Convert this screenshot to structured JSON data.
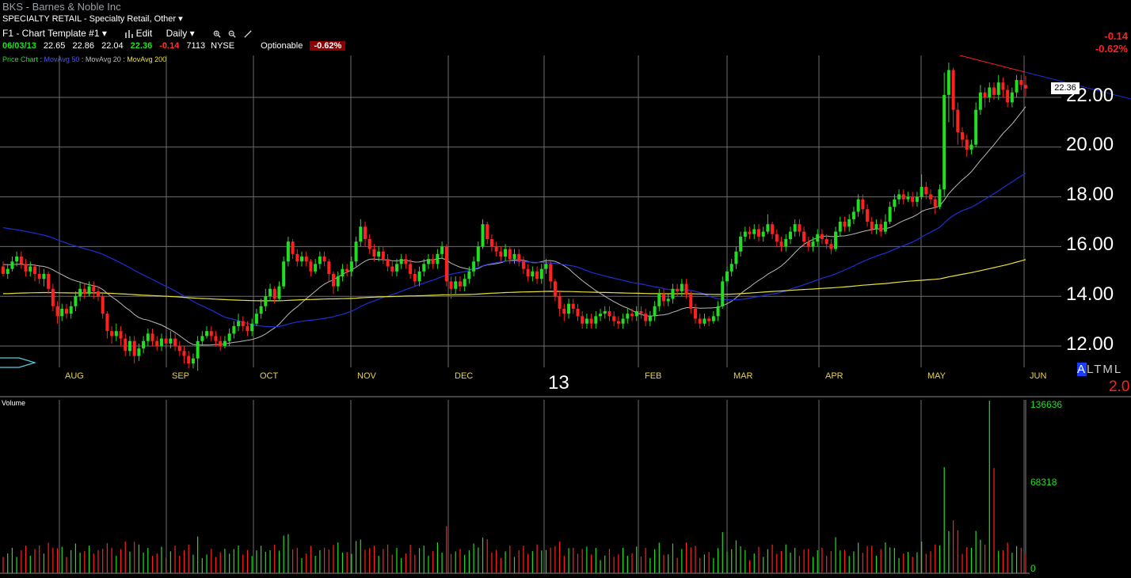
{
  "header": {
    "symbol": "BKS",
    "separator": " - ",
    "company": "Barnes & Noble Inc",
    "sector": "SPECIALTY RETAIL",
    "industry": "Specialty Retail, Other",
    "template": "F1 - Chart Template #1",
    "edit_label": "Edit",
    "period": "Daily"
  },
  "quote": {
    "date": "06/03/13",
    "open": "22.65",
    "high": "22.86",
    "low": "22.04",
    "close": "22.36",
    "change": "-0.14",
    "volume": "7113",
    "exchange": "NYSE",
    "optionable": "Optionable",
    "pct_change": "-0.62%"
  },
  "indicators": {
    "price_chart": "Price Chart",
    "ma50": "MovAvg 50",
    "ma20": "MovAvg 20",
    "ma200": "MovAvg 200",
    "sep": " : "
  },
  "right_panel": {
    "change": "-0.14",
    "pct": "-0.62%",
    "last_price_tag": "22.36",
    "alt_tabs": [
      "A",
      "L",
      "T",
      "M",
      "L"
    ],
    "corner_value": "2.0"
  },
  "year_label": "13",
  "volume_panel": {
    "label": "Volume",
    "ticks": [
      "136636",
      "68318",
      "0"
    ]
  },
  "colors": {
    "up": "#22dd22",
    "down": "#ff2020",
    "ma50": "#1e2fd6",
    "ma20": "#b8b8b8",
    "ma200": "#e8e03a",
    "grid": "#6e6e6e"
  },
  "chart_data": {
    "type": "candlestick",
    "y_ticks": [
      "22.00",
      "20.00",
      "18.00",
      "16.00",
      "14.00",
      "12.00"
    ],
    "ylim": [
      11.0,
      23.5
    ],
    "months": [
      "AUG",
      "SEP",
      "OCT",
      "NOV",
      "DEC",
      "FEB",
      "MAR",
      "APR",
      "MAY",
      "JUN"
    ],
    "x_axis": "trading days, Jul 2012 – Jun 2013",
    "candles": [
      [
        15.2,
        14.9,
        15.4,
        14.8
      ],
      [
        14.9,
        15.1,
        15.3,
        14.7
      ],
      [
        15.1,
        15.4,
        15.6,
        15.0
      ],
      [
        15.4,
        15.6,
        15.8,
        15.2
      ],
      [
        15.6,
        15.3,
        15.8,
        15.1
      ],
      [
        15.3,
        15.0,
        15.5,
        14.8
      ],
      [
        15.0,
        15.2,
        15.4,
        14.8
      ],
      [
        15.2,
        14.9,
        15.3,
        14.6
      ],
      [
        14.9,
        14.7,
        15.2,
        14.5
      ],
      [
        14.7,
        14.9,
        15.1,
        14.4
      ],
      [
        14.9,
        14.3,
        15.0,
        14.1
      ],
      [
        14.3,
        13.6,
        14.5,
        13.4
      ],
      [
        13.6,
        13.2,
        13.8,
        12.9
      ],
      [
        13.2,
        13.5,
        13.7,
        13.0
      ],
      [
        13.5,
        13.3,
        13.7,
        13.1
      ],
      [
        13.3,
        13.6,
        13.8,
        13.1
      ],
      [
        13.6,
        14.0,
        14.2,
        13.4
      ],
      [
        14.0,
        14.3,
        14.6,
        13.8
      ],
      [
        14.3,
        14.1,
        14.5,
        13.9
      ],
      [
        14.1,
        14.4,
        14.6,
        14.0
      ],
      [
        14.4,
        14.2,
        14.6,
        13.9
      ],
      [
        14.2,
        14.0,
        14.4,
        13.8
      ],
      [
        14.0,
        13.3,
        14.1,
        13.1
      ],
      [
        13.3,
        12.6,
        13.4,
        12.3
      ],
      [
        12.6,
        12.4,
        12.8,
        12.1
      ],
      [
        12.4,
        12.6,
        12.9,
        12.2
      ],
      [
        12.6,
        12.3,
        12.8,
        12.0
      ],
      [
        12.3,
        11.8,
        12.5,
        11.6
      ],
      [
        11.8,
        12.2,
        12.4,
        11.6
      ],
      [
        12.2,
        11.6,
        12.4,
        11.3
      ],
      [
        11.6,
        11.9,
        12.1,
        11.4
      ],
      [
        11.9,
        12.2,
        12.4,
        11.7
      ],
      [
        12.2,
        12.5,
        12.7,
        12.0
      ],
      [
        12.5,
        12.2,
        12.7,
        12.0
      ],
      [
        12.2,
        12.0,
        12.4,
        11.8
      ],
      [
        12.0,
        12.3,
        12.5,
        11.8
      ],
      [
        12.3,
        12.1,
        12.4,
        11.9
      ],
      [
        12.1,
        12.3,
        12.6,
        11.9
      ],
      [
        12.3,
        12.0,
        12.5,
        11.8
      ],
      [
        12.0,
        11.8,
        12.2,
        11.6
      ],
      [
        11.8,
        11.6,
        12.0,
        11.3
      ],
      [
        11.6,
        11.3,
        11.8,
        11.1
      ],
      [
        11.3,
        11.5,
        11.7,
        11.1
      ],
      [
        11.5,
        12.2,
        12.4,
        11.0
      ],
      [
        12.2,
        12.4,
        12.6,
        12.0
      ],
      [
        12.4,
        12.6,
        12.8,
        12.3
      ],
      [
        12.6,
        12.4,
        12.8,
        12.2
      ],
      [
        12.4,
        12.2,
        12.6,
        12.0
      ],
      [
        12.2,
        12.0,
        12.4,
        11.8
      ],
      [
        12.0,
        12.2,
        12.4,
        11.9
      ],
      [
        12.2,
        12.5,
        12.7,
        12.0
      ],
      [
        12.5,
        12.8,
        13.0,
        12.3
      ],
      [
        12.8,
        13.0,
        13.3,
        12.6
      ],
      [
        13.0,
        12.8,
        13.2,
        12.6
      ],
      [
        12.8,
        12.6,
        13.0,
        12.4
      ],
      [
        12.6,
        12.9,
        13.1,
        12.4
      ],
      [
        12.9,
        13.3,
        13.5,
        12.8
      ],
      [
        13.3,
        13.6,
        13.9,
        13.1
      ],
      [
        13.6,
        14.0,
        14.3,
        13.4
      ],
      [
        14.0,
        14.3,
        14.5,
        13.8
      ],
      [
        14.3,
        13.9,
        14.4,
        13.7
      ],
      [
        13.9,
        14.4,
        14.6,
        13.8
      ],
      [
        14.4,
        15.4,
        15.6,
        14.3
      ],
      [
        15.4,
        16.2,
        16.4,
        15.2
      ],
      [
        16.2,
        15.7,
        16.3,
        15.5
      ],
      [
        15.7,
        15.4,
        15.9,
        15.2
      ],
      [
        15.4,
        15.6,
        15.8,
        15.2
      ],
      [
        15.6,
        15.4,
        15.8,
        15.2
      ],
      [
        15.4,
        15.0,
        15.5,
        14.8
      ],
      [
        15.0,
        15.3,
        15.5,
        14.9
      ],
      [
        15.3,
        15.6,
        15.8,
        15.1
      ],
      [
        15.6,
        15.4,
        15.8,
        15.2
      ],
      [
        15.4,
        14.9,
        15.5,
        14.6
      ],
      [
        14.9,
        14.4,
        15.0,
        14.1
      ],
      [
        14.4,
        14.8,
        15.0,
        14.2
      ],
      [
        14.8,
        15.1,
        15.3,
        14.6
      ],
      [
        15.1,
        15.0,
        15.3,
        14.8
      ],
      [
        15.0,
        15.4,
        15.6,
        14.8
      ],
      [
        15.4,
        16.2,
        16.4,
        15.2
      ],
      [
        16.2,
        16.8,
        17.1,
        16.0
      ],
      [
        16.8,
        16.3,
        17.0,
        16.0
      ],
      [
        16.3,
        15.9,
        16.5,
        15.7
      ],
      [
        15.9,
        15.6,
        16.1,
        15.4
      ],
      [
        15.6,
        15.8,
        16.0,
        15.4
      ],
      [
        15.8,
        15.5,
        16.0,
        15.3
      ],
      [
        15.5,
        15.2,
        15.7,
        15.0
      ],
      [
        15.2,
        15.0,
        15.4,
        14.8
      ],
      [
        15.0,
        15.3,
        15.5,
        14.8
      ],
      [
        15.3,
        15.5,
        15.7,
        15.1
      ],
      [
        15.5,
        15.3,
        15.7,
        15.1
      ],
      [
        15.3,
        14.9,
        15.5,
        14.7
      ],
      [
        14.9,
        14.6,
        15.1,
        14.4
      ],
      [
        14.6,
        15.0,
        15.2,
        14.4
      ],
      [
        15.0,
        15.3,
        15.5,
        14.8
      ],
      [
        15.3,
        15.5,
        15.7,
        15.1
      ],
      [
        15.5,
        15.3,
        15.7,
        15.1
      ],
      [
        15.3,
        15.7,
        15.9,
        15.1
      ],
      [
        15.7,
        16.0,
        16.2,
        15.5
      ],
      [
        16.0,
        14.6,
        16.1,
        14.4
      ],
      [
        14.6,
        14.3,
        14.8,
        13.9
      ],
      [
        14.3,
        14.6,
        14.8,
        14.1
      ],
      [
        14.6,
        14.4,
        14.8,
        14.2
      ],
      [
        14.4,
        14.7,
        14.9,
        14.2
      ],
      [
        14.7,
        15.0,
        15.2,
        14.5
      ],
      [
        15.0,
        15.4,
        15.6,
        14.8
      ],
      [
        15.4,
        16.0,
        16.2,
        15.2
      ],
      [
        16.0,
        16.9,
        17.1,
        15.9
      ],
      [
        16.9,
        16.3,
        17.0,
        16.1
      ],
      [
        16.3,
        16.0,
        16.5,
        15.8
      ],
      [
        16.0,
        15.8,
        16.2,
        15.6
      ],
      [
        15.8,
        15.6,
        16.0,
        15.4
      ],
      [
        15.6,
        15.9,
        16.1,
        15.4
      ],
      [
        15.9,
        15.5,
        16.0,
        15.3
      ],
      [
        15.5,
        15.7,
        15.9,
        15.3
      ],
      [
        15.7,
        15.4,
        15.9,
        15.2
      ],
      [
        15.4,
        15.1,
        15.6,
        14.9
      ],
      [
        15.1,
        14.8,
        15.3,
        14.6
      ],
      [
        14.8,
        15.0,
        15.2,
        14.6
      ],
      [
        15.0,
        14.7,
        15.2,
        14.5
      ],
      [
        14.7,
        15.1,
        15.3,
        14.5
      ],
      [
        15.1,
        15.3,
        15.5,
        14.9
      ],
      [
        15.3,
        14.6,
        15.4,
        14.3
      ],
      [
        14.6,
        14.0,
        14.7,
        13.8
      ],
      [
        14.0,
        13.5,
        14.2,
        13.2
      ],
      [
        13.5,
        13.3,
        13.7,
        13.0
      ],
      [
        13.3,
        13.7,
        13.9,
        13.1
      ],
      [
        13.7,
        13.5,
        13.9,
        13.3
      ],
      [
        13.5,
        13.2,
        13.7,
        13.0
      ],
      [
        13.2,
        12.9,
        13.4,
        12.7
      ],
      [
        12.9,
        13.1,
        13.3,
        12.7
      ],
      [
        13.1,
        12.9,
        13.3,
        12.7
      ],
      [
        12.9,
        13.2,
        13.4,
        12.7
      ],
      [
        13.2,
        13.3,
        13.5,
        13.0
      ],
      [
        13.3,
        13.4,
        13.6,
        13.1
      ],
      [
        13.4,
        13.2,
        13.6,
        13.0
      ],
      [
        13.2,
        13.0,
        13.4,
        12.8
      ],
      [
        13.0,
        12.9,
        13.2,
        12.7
      ],
      [
        12.9,
        13.1,
        13.3,
        12.7
      ],
      [
        13.1,
        13.3,
        13.5,
        12.9
      ],
      [
        13.3,
        13.2,
        13.5,
        13.0
      ],
      [
        13.2,
        13.4,
        13.6,
        13.0
      ],
      [
        13.4,
        13.3,
        13.6,
        13.1
      ],
      [
        13.3,
        13.0,
        13.5,
        12.8
      ],
      [
        13.0,
        13.2,
        13.4,
        12.8
      ],
      [
        13.2,
        13.6,
        13.8,
        13.0
      ],
      [
        13.6,
        14.1,
        14.3,
        13.4
      ],
      [
        14.1,
        13.8,
        14.3,
        13.6
      ],
      [
        13.8,
        13.9,
        14.1,
        13.6
      ],
      [
        13.9,
        14.3,
        14.5,
        13.7
      ],
      [
        14.3,
        14.2,
        14.5,
        14.0
      ],
      [
        14.2,
        14.5,
        14.7,
        14.0
      ],
      [
        14.5,
        14.1,
        14.7,
        13.9
      ],
      [
        14.1,
        13.5,
        14.2,
        13.3
      ],
      [
        13.5,
        13.1,
        13.7,
        12.9
      ],
      [
        13.1,
        12.9,
        13.3,
        12.7
      ],
      [
        12.9,
        13.1,
        13.3,
        12.8
      ],
      [
        13.1,
        13.0,
        13.2,
        12.8
      ],
      [
        13.0,
        13.2,
        13.4,
        12.9
      ],
      [
        13.2,
        13.6,
        13.8,
        13.0
      ],
      [
        13.6,
        14.6,
        14.8,
        13.5
      ],
      [
        14.6,
        15.0,
        15.2,
        14.4
      ],
      [
        15.0,
        15.3,
        15.5,
        14.8
      ],
      [
        15.3,
        15.8,
        16.0,
        15.1
      ],
      [
        15.8,
        16.4,
        16.6,
        15.6
      ],
      [
        16.4,
        16.6,
        16.8,
        16.2
      ],
      [
        16.6,
        16.5,
        16.8,
        16.3
      ],
      [
        16.5,
        16.7,
        16.9,
        16.3
      ],
      [
        16.7,
        16.4,
        16.9,
        16.2
      ],
      [
        16.4,
        16.6,
        16.8,
        16.2
      ],
      [
        16.6,
        16.9,
        17.3,
        16.5
      ],
      [
        16.9,
        16.5,
        17.0,
        16.3
      ],
      [
        16.5,
        16.2,
        16.7,
        16.0
      ],
      [
        16.2,
        16.0,
        16.4,
        15.8
      ],
      [
        16.0,
        16.3,
        16.5,
        15.8
      ],
      [
        16.3,
        16.6,
        16.8,
        16.1
      ],
      [
        16.6,
        16.9,
        17.1,
        16.4
      ],
      [
        16.9,
        16.6,
        17.1,
        16.4
      ],
      [
        16.6,
        16.2,
        16.8,
        16.0
      ],
      [
        16.2,
        16.0,
        16.4,
        15.8
      ],
      [
        16.0,
        16.2,
        16.4,
        15.8
      ],
      [
        16.2,
        16.5,
        16.7,
        16.0
      ],
      [
        16.5,
        16.3,
        16.7,
        16.1
      ],
      [
        16.3,
        16.1,
        16.5,
        15.9
      ],
      [
        16.1,
        15.9,
        16.3,
        15.7
      ],
      [
        15.9,
        16.6,
        16.8,
        15.8
      ],
      [
        16.6,
        17.0,
        17.2,
        16.4
      ],
      [
        17.0,
        16.8,
        17.2,
        16.6
      ],
      [
        16.8,
        17.1,
        17.3,
        16.6
      ],
      [
        17.1,
        17.4,
        17.6,
        16.9
      ],
      [
        17.4,
        17.9,
        18.1,
        17.2
      ],
      [
        17.9,
        17.5,
        18.1,
        17.3
      ],
      [
        17.5,
        17.0,
        17.7,
        16.8
      ],
      [
        17.0,
        16.7,
        17.2,
        16.5
      ],
      [
        16.7,
        16.9,
        17.1,
        16.5
      ],
      [
        16.9,
        16.6,
        17.1,
        16.4
      ],
      [
        16.6,
        17.0,
        17.3,
        16.5
      ],
      [
        17.0,
        17.6,
        17.8,
        16.9
      ],
      [
        17.6,
        17.9,
        18.1,
        17.4
      ],
      [
        17.9,
        18.1,
        18.3,
        17.7
      ],
      [
        18.1,
        17.9,
        18.3,
        17.7
      ],
      [
        17.9,
        18.0,
        18.2,
        17.8
      ],
      [
        18.0,
        17.8,
        18.2,
        17.6
      ],
      [
        17.8,
        18.0,
        18.2,
        17.6
      ],
      [
        18.0,
        18.4,
        18.9,
        17.9
      ],
      [
        18.4,
        18.1,
        18.6,
        17.9
      ],
      [
        18.1,
        17.9,
        18.3,
        17.7
      ],
      [
        17.9,
        17.6,
        18.0,
        17.3
      ],
      [
        17.6,
        18.3,
        18.5,
        17.5
      ],
      [
        18.3,
        22.1,
        23.0,
        18.0
      ],
      [
        22.1,
        23.1,
        23.4,
        21.0
      ],
      [
        23.1,
        21.5,
        23.2,
        20.8
      ],
      [
        21.5,
        20.6,
        21.8,
        20.1
      ],
      [
        20.6,
        20.3,
        20.8,
        20.0
      ],
      [
        20.3,
        19.9,
        20.5,
        19.6
      ],
      [
        19.9,
        20.1,
        20.3,
        19.7
      ],
      [
        20.1,
        21.5,
        21.8,
        20.0
      ],
      [
        21.5,
        22.2,
        22.5,
        21.3
      ],
      [
        22.2,
        22.0,
        22.4,
        21.6
      ],
      [
        22.0,
        22.4,
        22.6,
        21.8
      ],
      [
        22.4,
        22.1,
        22.6,
        21.9
      ],
      [
        22.1,
        22.6,
        22.9,
        21.9
      ],
      [
        22.6,
        22.3,
        22.8,
        22.0
      ],
      [
        22.3,
        21.8,
        22.5,
        21.6
      ],
      [
        21.8,
        22.2,
        22.4,
        21.6
      ],
      [
        22.2,
        22.7,
        22.9,
        22.0
      ],
      [
        22.7,
        22.5,
        22.9,
        22.3
      ],
      [
        22.5,
        22.36,
        22.86,
        22.04
      ]
    ],
    "volume_max": 136636
  }
}
